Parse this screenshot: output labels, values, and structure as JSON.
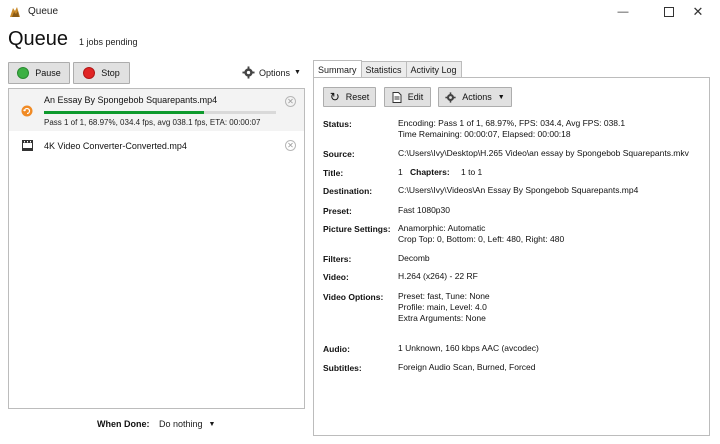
{
  "window": {
    "title": "Queue",
    "minimize_icon": "minimize-icon",
    "maximize_icon": "maximize-icon",
    "close_icon": "close-icon"
  },
  "header": {
    "title": "Queue",
    "jobs_pending": "1 jobs pending"
  },
  "toolbar": {
    "pause_label": "Pause",
    "stop_label": "Stop",
    "options_label": "Options"
  },
  "jobs": [
    {
      "name": "An Essay By Spongebob Squarepants.mp4",
      "status": "Pass 1 of 1, 68.97%, 034.4 fps, avg 038.1 fps, ETA: 00:00:07",
      "progress": 0.6897,
      "icon": "encoding-icon"
    },
    {
      "name": "4K Video Converter-Converted.mp4",
      "icon": "film-icon"
    }
  ],
  "when_done": {
    "label": "When Done:",
    "value": "Do nothing"
  },
  "tabs": [
    "Summary",
    "Statistics",
    "Activity Log"
  ],
  "actions": {
    "reset_label": "Reset",
    "edit_label": "Edit",
    "actions_label": "Actions"
  },
  "summary": {
    "status_label": "Status:",
    "status_line1": "Encoding: Pass 1 of 1,  68.97%, FPS: 034.4,  Avg FPS: 038.1",
    "status_line2": "Time Remaining: 00:00:07,  Elapsed: 00:00:18",
    "source_label": "Source:",
    "source": "C:\\Users\\Ivy\\Desktop\\H.265 Video\\an essay by Spongebob Squarepants.mkv",
    "title_label": "Title:",
    "title_value": "1",
    "chapters_label": "Chapters:",
    "chapters_value": "1  to  1",
    "destination_label": "Destination:",
    "destination": "C:\\Users\\Ivy\\Videos\\An Essay By Spongebob Squarepants.mp4",
    "preset_label": "Preset:",
    "preset": "Fast 1080p30",
    "picture_label": "Picture Settings:",
    "picture_line1": "Anamorphic: Automatic",
    "picture_line2": "Crop Top: 0, Bottom: 0, Left: 480, Right: 480",
    "filters_label": "Filters:",
    "filters": "Decomb",
    "video_label": "Video:",
    "video": "H.264 (x264) - 22 RF",
    "video_options_label": "Video Options:",
    "video_options_line1": "Preset: fast, Tune: None",
    "video_options_line2": "Profile: main, Level: 4.0",
    "video_options_line3": "Extra Arguments: None",
    "audio_label": "Audio:",
    "audio": "1 Unknown, 160 kbps AAC (avcodec)",
    "subtitles_label": "Subtitles:",
    "subtitles": "Foreign Audio Scan, Burned, Forced"
  },
  "colors": {
    "progress": "#0e9a2d",
    "pause_green": "#3cb043",
    "stop_red": "#e02424",
    "encoding_orange": "#f08a24"
  }
}
